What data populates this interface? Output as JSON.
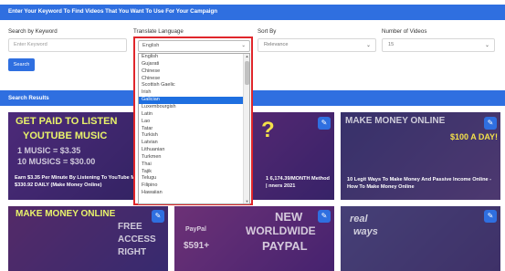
{
  "header": {
    "title": "Enter Your Keyword To Find Videos That You Want To Use For Your Campaign"
  },
  "form": {
    "keyword": {
      "label": "Search by Keyword",
      "placeholder": "Enter Keyword"
    },
    "language": {
      "label": "Translate Language",
      "value": "English"
    },
    "sort": {
      "label": "Sort By",
      "value": "Relevance"
    },
    "count": {
      "label": "Number of Videos",
      "value": "15"
    },
    "search_label": "Search"
  },
  "results": {
    "title": "Search Results",
    "cards": [
      {
        "thumb_text_1": "GET PAID TO LISTEN",
        "thumb_text_2": "YOUTUBE MUSIC",
        "thumb_text_3": "1 MUSIC = $3.35",
        "thumb_text_4": "10 MUSICS = $30.00",
        "caption": "Earn $3.35 Per Minute By Listening To YouTube MAKE $330.92 DAILY (Make Money Online)"
      },
      {
        "thumb_text_1": "?",
        "caption": "1 6,174.39/MONTH Method | nners 2021"
      },
      {
        "thumb_text_1": "MAKE MONEY ONLINE",
        "thumb_text_2": "$100 A DAY!",
        "caption": "10 Legit Ways To Make Money And Passive Income Online - How To Make Money Online"
      },
      {
        "thumb_text_1": "MAKE MONEY ONLINE",
        "thumb_text_2": "FREE",
        "thumb_text_3": "ACCESS",
        "thumb_text_4": "RIGHT",
        "caption": ""
      },
      {
        "thumb_text_1": "NEW",
        "thumb_text_2": "WORLDWIDE",
        "thumb_text_3": "PAYPAL",
        "thumb_text_4": "$591+",
        "thumb_text_5": "PayPal",
        "caption": ""
      },
      {
        "thumb_text_1": "real",
        "thumb_text_2": "ways",
        "caption": ""
      }
    ]
  },
  "language_dropdown": {
    "selected": "English",
    "options": [
      "English",
      "Gujarati",
      "Chinese",
      "Chinese",
      "Scottish Gaelic",
      "Irish",
      "Galician",
      "Luxembourgish",
      "Latin",
      "Lao",
      "Tatar",
      "Turkish",
      "Latvian",
      "Lithuanian",
      "Turkmen",
      "Thai",
      "Tajik",
      "Telugu",
      "Filipino",
      "Hawaiian"
    ],
    "highlighted_index": 6
  },
  "icons": {
    "edit": "edit-icon",
    "chevron": "chevron-down-icon"
  },
  "colors": {
    "accent": "#2f6fe0",
    "highlight": "#e0262b"
  }
}
